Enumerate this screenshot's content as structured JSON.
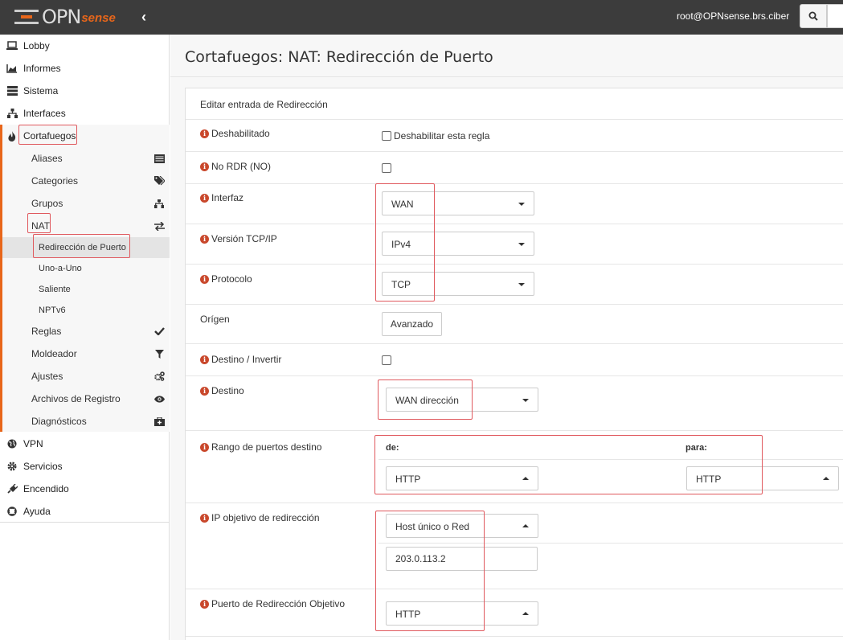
{
  "topbar": {
    "logo_text": "OPN",
    "logo_suffix": "sense",
    "collapse_glyph": "‹",
    "user": "root@OPNsense.brs.ciber",
    "search_icon": "search-icon"
  },
  "sidebar": {
    "items": [
      {
        "label": "Lobby",
        "icon": "laptop-icon"
      },
      {
        "label": "Informes",
        "icon": "area-chart-icon"
      },
      {
        "label": "Sistema",
        "icon": "server-icon"
      },
      {
        "label": "Interfaces",
        "icon": "sitemap-icon"
      },
      {
        "label": "Cortafuegos",
        "icon": "fire-icon"
      },
      {
        "label": "VPN",
        "icon": "globe-icon"
      },
      {
        "label": "Servicios",
        "icon": "cog-icon"
      },
      {
        "label": "Encendido",
        "icon": "plug-icon"
      },
      {
        "label": "Ayuda",
        "icon": "life-ring-icon"
      }
    ],
    "firewall_sub": [
      {
        "label": "Aliases",
        "icon": "list-icon"
      },
      {
        "label": "Categories",
        "icon": "tags-icon"
      },
      {
        "label": "Grupos",
        "icon": "sitemap-icon"
      },
      {
        "label": "NAT",
        "icon": "exchange-icon"
      },
      {
        "label": "Reglas",
        "icon": "check-icon"
      },
      {
        "label": "Moldeador",
        "icon": "filter-icon"
      },
      {
        "label": "Ajustes",
        "icon": "cogs-icon"
      },
      {
        "label": "Archivos de Registro",
        "icon": "eye-icon"
      },
      {
        "label": "Diagnósticos",
        "icon": "medkit-icon"
      }
    ],
    "nat_sub": [
      "Redirección de Puerto",
      "Uno-a-Uno",
      "Saliente",
      "NPTv6"
    ],
    "accent_color": "#e8661a"
  },
  "main": {
    "title": "Cortafuegos: NAT: Redirección de Puerto",
    "panel_header": "Editar entrada de Redirección",
    "rows": {
      "disabled": {
        "label": "Deshabilitado",
        "checkbox_label": "Deshabilitar esta regla"
      },
      "nordr": {
        "label": "No RDR (NO)"
      },
      "interface": {
        "label": "Interfaz",
        "value": "WAN"
      },
      "tcpip": {
        "label": "Versión TCP/IP",
        "value": "IPv4"
      },
      "protocol": {
        "label": "Protocolo",
        "value": "TCP"
      },
      "source": {
        "label": "Orígen",
        "button": "Avanzado"
      },
      "dest_invert": {
        "label": "Destino / Invertir"
      },
      "destination": {
        "label": "Destino",
        "value": "WAN dirección"
      },
      "dest_port_range": {
        "label": "Rango de puertos destino",
        "from_label": "de:",
        "to_label": "para:",
        "from_value": "HTTP",
        "to_value": "HTTP"
      },
      "redirect_ip": {
        "label": "IP objetivo de redirección",
        "select_value": "Host único o Red",
        "input_value": "203.0.113.2"
      },
      "redirect_port": {
        "label": "Puerto de Redirección Objetivo",
        "value": "HTTP"
      }
    }
  },
  "colors": {
    "highlight": "#e0595e",
    "topbar": "#3c3c3c",
    "info_icon": "#c9482c"
  }
}
